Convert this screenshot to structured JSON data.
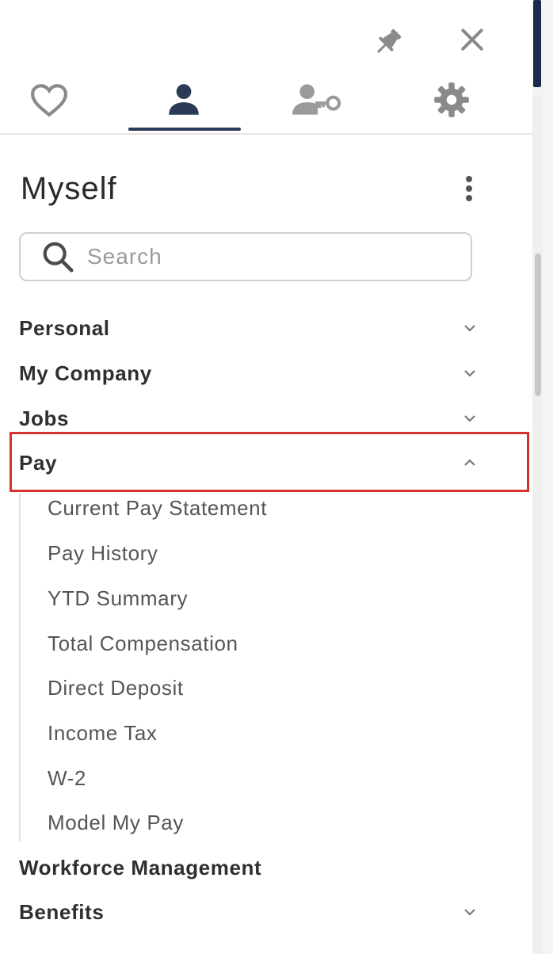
{
  "tabs": [
    {
      "name": "favorites",
      "icon": "heart-icon"
    },
    {
      "name": "myself",
      "icon": "person-icon",
      "active": true
    },
    {
      "name": "people",
      "icon": "person-key-icon"
    },
    {
      "name": "settings",
      "icon": "gear-icon"
    }
  ],
  "panel": {
    "title": "Myself"
  },
  "search": {
    "placeholder": "Search"
  },
  "sections": [
    {
      "label": "Personal",
      "expanded": false
    },
    {
      "label": "My Company",
      "expanded": false
    },
    {
      "label": "Jobs",
      "expanded": false
    },
    {
      "label": "Pay",
      "expanded": true,
      "highlighted": true
    },
    {
      "label": "Workforce Management",
      "expanded": false
    },
    {
      "label": "Benefits",
      "expanded": false
    }
  ],
  "pay_items": [
    "Current Pay Statement",
    "Pay History",
    "YTD Summary",
    "Total Compensation",
    "Direct Deposit",
    "Income Tax",
    "W-2",
    "Model My Pay"
  ],
  "colors": {
    "accent": "#2b3a57",
    "highlight_border": "#d6312d",
    "icon_gray": "#8a8a8a",
    "text_dark": "#2f2f2f",
    "text_sub": "#555555"
  }
}
